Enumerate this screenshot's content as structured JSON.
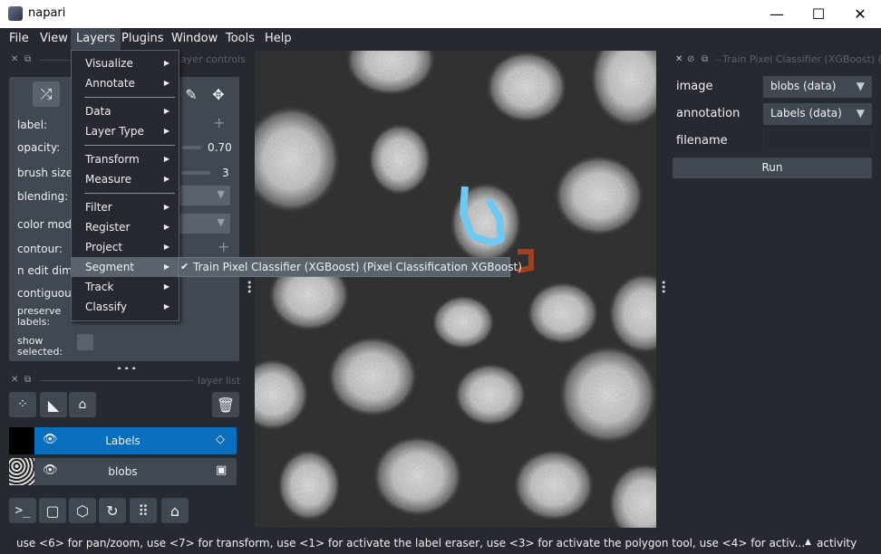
{
  "window": {
    "title": "napari",
    "minimize": "—",
    "maximize": "☐",
    "close": "✕"
  },
  "menubar": [
    "File",
    "View",
    "Layers",
    "Plugins",
    "Window",
    "Tools",
    "Help"
  ],
  "layer_controls": {
    "header": "layer controls",
    "rows": [
      {
        "label": "label:"
      },
      {
        "label": "opacity:",
        "value": "0.70"
      },
      {
        "label": "brush size:",
        "value": "3"
      },
      {
        "label": "blending:"
      },
      {
        "label": "color mode:"
      },
      {
        "label": "contour:"
      },
      {
        "label": "n edit dim:"
      },
      {
        "label": "contiguous:"
      },
      {
        "label": "preserve\nlabels:"
      },
      {
        "label": "show\nselected:"
      }
    ]
  },
  "layer_list": {
    "header": "layer list",
    "layers": [
      {
        "name": "Labels",
        "selected": true
      },
      {
        "name": "blobs",
        "selected": false
      }
    ]
  },
  "layers_menu": {
    "items": [
      "Visualize",
      "Annotate",
      "Data",
      "Layer Type",
      "Transform",
      "Measure",
      "Filter",
      "Register",
      "Project",
      "Segment",
      "Track",
      "Classify"
    ],
    "highlighted": "Segment",
    "submenu_item": "Train Pixel Classifier (XGBoost) (Pixel Classification XGBoost)",
    "submenu_check": "✔"
  },
  "plugin_dock": {
    "title": "Train Pixel Classifier (XGBoost) (Pix",
    "fields": [
      {
        "label": "image",
        "value": "blobs (data)"
      },
      {
        "label": "annotation",
        "value": "Labels (data)"
      },
      {
        "label": "filename",
        "value": ""
      }
    ],
    "run_label": "Run"
  },
  "statusbar": {
    "text": "use <6> for pan/zoom, use <7> for transform, use <1> for activate the label eraser, use <3> for activate the polygon tool, use <4> for activ...",
    "activity": "activity",
    "activity_arrow": "▲"
  },
  "colors": {
    "accent": "#0a6ebd",
    "bg": "#262930",
    "panel": "#414851",
    "annotation": "#6ec8f0",
    "label_brown": "#a0401c"
  }
}
